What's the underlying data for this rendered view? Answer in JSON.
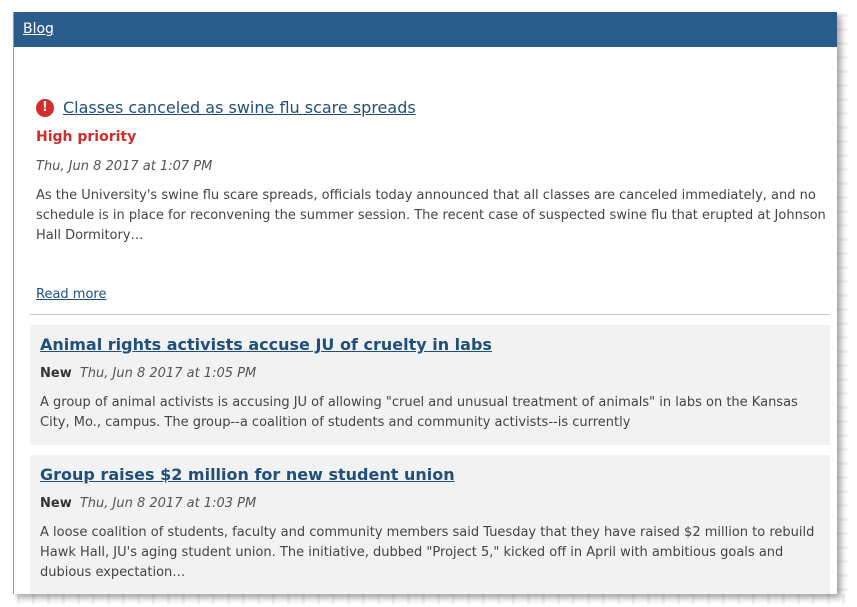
{
  "header": {
    "blog_link": "Blog"
  },
  "featured": {
    "title": "Classes canceled as swine flu scare spreads",
    "priority": "High priority",
    "date": "Thu, Jun 8 2017 at 1:07 PM",
    "excerpt": "As the University's swine flu scare spreads, officials today announced that all classes are canceled immediately, and no schedule is in place for reconvening the summer session. The recent case of suspected swine flu that erupted at Johnson Hall Dormitory…",
    "read_more": "Read more",
    "icon": "alert-icon",
    "alert_color": "#d42b2b"
  },
  "posts": [
    {
      "title": "Animal rights activists accuse JU of cruelty in labs",
      "badge": "New",
      "date": "Thu, Jun 8 2017 at 1:05 PM",
      "excerpt": "A group of animal activists is accusing JU of allowing \"cruel and unusual treatment of animals\" in labs on the Kansas City, Mo., campus. The group--a coalition of students and community activists--is currently"
    },
    {
      "title": "Group raises $2 million for new student union",
      "badge": "New",
      "date": "Thu, Jun 8 2017 at 1:03 PM",
      "excerpt": "A loose coalition of students, faculty and community members said Tuesday that they have raised $2 million to rebuild Hawk Hall, JU's aging student union. The initiative, dubbed \"Project 5,\" kicked off in April with ambitious goals and dubious expectation…"
    }
  ],
  "colors": {
    "header_bg": "#2a5d8c",
    "link": "#1f4f7a",
    "card_bg": "#f2f2f2"
  }
}
